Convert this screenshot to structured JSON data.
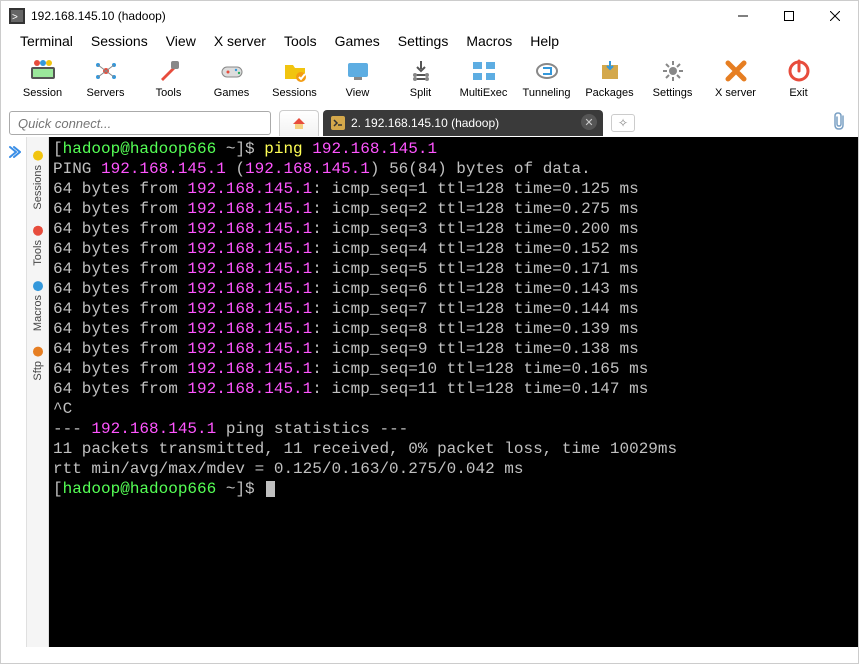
{
  "title": "192.168.145.10 (hadoop)",
  "menus": [
    "Terminal",
    "Sessions",
    "View",
    "X server",
    "Tools",
    "Games",
    "Settings",
    "Macros",
    "Help"
  ],
  "toolbar": [
    {
      "label": "Session",
      "icon": "session"
    },
    {
      "label": "Servers",
      "icon": "servers"
    },
    {
      "label": "Tools",
      "icon": "tools"
    },
    {
      "label": "Games",
      "icon": "games"
    },
    {
      "label": "Sessions",
      "icon": "folder"
    },
    {
      "label": "View",
      "icon": "view"
    },
    {
      "label": "Split",
      "icon": "split"
    },
    {
      "label": "MultiExec",
      "icon": "multiexec"
    },
    {
      "label": "Tunneling",
      "icon": "tunneling"
    },
    {
      "label": "Packages",
      "icon": "packages"
    },
    {
      "label": "Settings",
      "icon": "settings"
    },
    {
      "label": "X server",
      "icon": "xserver"
    },
    {
      "label": "Exit",
      "icon": "exit"
    }
  ],
  "quick_connect_placeholder": "Quick connect...",
  "tab": {
    "label": "2. 192.168.145.10 (hadoop)",
    "index": "2"
  },
  "sidetabs": [
    "Sessions",
    "Tools",
    "Macros",
    "Sftp"
  ],
  "terminal": {
    "user": "hadoop",
    "host": "hadoop666",
    "cwd": "~",
    "cmd": "ping",
    "target": "192.168.145.1",
    "ping_header_a": "PING ",
    "ping_header_b": " (",
    "ping_header_c": ") 56(84) bytes of data.",
    "lines": [
      {
        "ip": "192.168.145.1",
        "seq": "1",
        "ttl": "128",
        "time": "0.125"
      },
      {
        "ip": "192.168.145.1",
        "seq": "2",
        "ttl": "128",
        "time": "0.275"
      },
      {
        "ip": "192.168.145.1",
        "seq": "3",
        "ttl": "128",
        "time": "0.200"
      },
      {
        "ip": "192.168.145.1",
        "seq": "4",
        "ttl": "128",
        "time": "0.152"
      },
      {
        "ip": "192.168.145.1",
        "seq": "5",
        "ttl": "128",
        "time": "0.171"
      },
      {
        "ip": "192.168.145.1",
        "seq": "6",
        "ttl": "128",
        "time": "0.143"
      },
      {
        "ip": "192.168.145.1",
        "seq": "7",
        "ttl": "128",
        "time": "0.144"
      },
      {
        "ip": "192.168.145.1",
        "seq": "8",
        "ttl": "128",
        "time": "0.139"
      },
      {
        "ip": "192.168.145.1",
        "seq": "9",
        "ttl": "128",
        "time": "0.138"
      },
      {
        "ip": "192.168.145.1",
        "seq": "10",
        "ttl": "128",
        "time": "0.165"
      },
      {
        "ip": "192.168.145.1",
        "seq": "11",
        "ttl": "128",
        "time": "0.147"
      }
    ],
    "interrupt": "^C",
    "stats_header_a": "--- ",
    "stats_header_b": " ping statistics ---",
    "stats1": "11 packets transmitted, 11 received, 0% packet loss, time 10029ms",
    "stats2": "rtt min/avg/max/mdev = 0.125/0.163/0.275/0.042 ms"
  }
}
